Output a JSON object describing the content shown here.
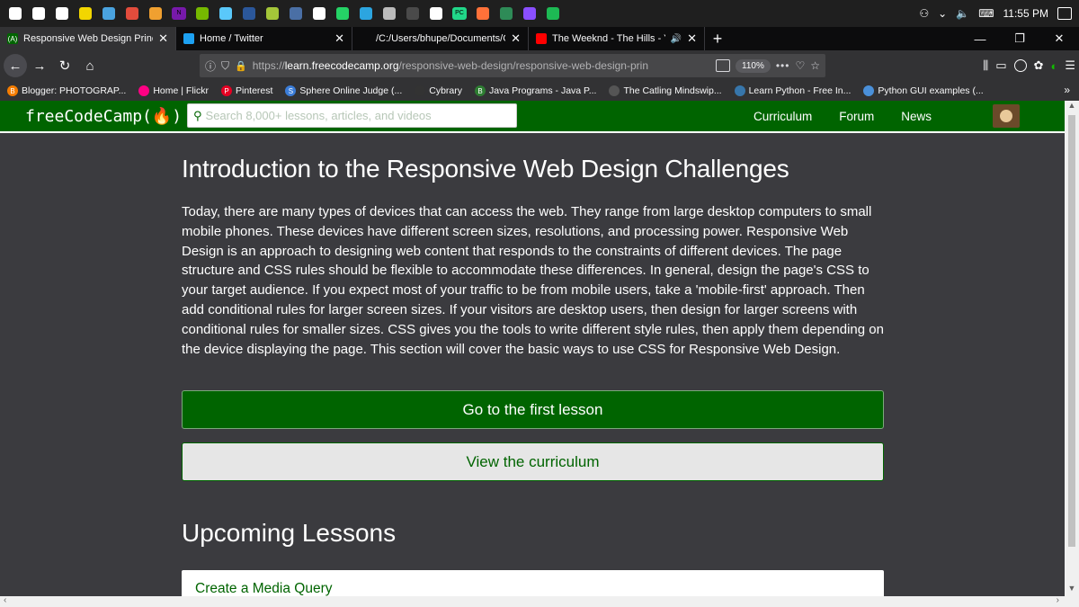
{
  "taskbar": {
    "pinned_icons": [
      {
        "name": "start-icon",
        "color": "#ffffff"
      },
      {
        "name": "task-view-icon",
        "color": "#ffffff"
      },
      {
        "name": "mail-icon",
        "color": "#ffffff"
      },
      {
        "name": "sticky-notes-icon",
        "color": "#f2d600"
      },
      {
        "name": "files-icon",
        "color": "#4aa3df"
      },
      {
        "name": "chrome-icon",
        "color": "#e24c3c"
      },
      {
        "name": "photos-icon",
        "color": "#f0a030"
      },
      {
        "name": "onenote-icon",
        "color": "#7719aa",
        "label": "N"
      },
      {
        "name": "gfe-icon",
        "color": "#76b900"
      },
      {
        "name": "itunes-icon",
        "color": "#5ac8fa"
      },
      {
        "name": "word-icon",
        "color": "#2b579a"
      },
      {
        "name": "android-icon",
        "color": "#a4c639"
      },
      {
        "name": "media-icon",
        "color": "#4a6fa5"
      },
      {
        "name": "opera-icon",
        "color": "#ffffff"
      },
      {
        "name": "whatsapp-icon",
        "color": "#25d366"
      },
      {
        "name": "telegram-icon",
        "color": "#2ca5e0"
      },
      {
        "name": "vscode-icon",
        "color": "#bbbbbb"
      },
      {
        "name": "sublime-icon",
        "color": "#4a4a4a"
      },
      {
        "name": "git-icon",
        "color": "#ffffff"
      },
      {
        "name": "pycharm-icon",
        "color": "#21d789",
        "label": "PC"
      },
      {
        "name": "firefox-icon",
        "color": "#ff7139"
      },
      {
        "name": "app-green-icon",
        "color": "#2e8b57"
      },
      {
        "name": "app-purple-icon",
        "color": "#8a4fff"
      },
      {
        "name": "spotify-icon",
        "color": "#1db954"
      }
    ],
    "clock": "11:55 PM"
  },
  "tabs": [
    {
      "title": "Responsive Web Design Princip",
      "favicon_color": "#006400",
      "favicon": "(A)",
      "active": true,
      "has_close": true
    },
    {
      "title": "Home / Twitter",
      "favicon_color": "#1da1f2",
      "favicon": "",
      "active": false,
      "has_close": true
    },
    {
      "title": "/C:/Users/bhupe/Documents/GitHu",
      "favicon_color": "",
      "favicon": "",
      "active": false,
      "has_close": true
    },
    {
      "title": "The Weeknd - The Hills - Yo",
      "favicon_color": "#ff0000",
      "favicon": "",
      "active": false,
      "has_close": true,
      "has_audio": true
    }
  ],
  "navbar": {
    "url_prefix": "https://",
    "url_host": "learn.freecodecamp.org",
    "url_path": "/responsive-web-design/responsive-web-design-prin",
    "zoom": "110%"
  },
  "bookmarks": [
    {
      "label": "Blogger: PHOTOGRAP...",
      "color": "#f57d00",
      "glyph": "B"
    },
    {
      "label": "Home | Flickr",
      "color": "#ff0084",
      "glyph": ""
    },
    {
      "label": "Pinterest",
      "color": "#e60023",
      "glyph": "P"
    },
    {
      "label": "Sphere Online Judge (...",
      "color": "#3b7dd8",
      "glyph": "S"
    },
    {
      "label": "Cybrary",
      "color": "#333333",
      "glyph": ""
    },
    {
      "label": "Java Programs - Java P...",
      "color": "#2e7d32",
      "glyph": "B"
    },
    {
      "label": "The Catling Mindswip...",
      "color": "#555555",
      "glyph": ""
    },
    {
      "label": "Learn Python - Free In...",
      "color": "#3776ab",
      "glyph": ""
    },
    {
      "label": "Python GUI examples (...",
      "color": "#4a90d9",
      "glyph": ""
    }
  ],
  "fcc": {
    "logo": "freeCodeCamp(🔥)",
    "search_placeholder": "Search 8,000+ lessons, articles, and videos",
    "nav_links": [
      "Curriculum",
      "Forum",
      "News"
    ]
  },
  "content": {
    "title": "Introduction to the Responsive Web Design Challenges",
    "paragraph": "Today, there are many types of devices that can access the web. They range from large desktop computers to small mobile phones. These devices have different screen sizes, resolutions, and processing power. Responsive Web Design is an approach to designing web content that responds to the constraints of different devices. The page structure and CSS rules should be flexible to accommodate these differences. In general, design the page's CSS to your target audience. If you expect most of your traffic to be from mobile users, take a 'mobile-first' approach. Then add conditional rules for larger screen sizes. If your visitors are desktop users, then design for larger screens with conditional rules for smaller sizes. CSS gives you the tools to write different style rules, then apply them depending on the device displaying the page. This section will cover the basic ways to use CSS for Responsive Web Design.",
    "primary_button": "Go to the first lesson",
    "secondary_button": "View the curriculum",
    "upcoming_heading": "Upcoming Lessons",
    "lessons": [
      "Create a Media Query"
    ]
  },
  "colors": {
    "fcc_green": "#006400",
    "page_bg": "#3b3b3f"
  }
}
